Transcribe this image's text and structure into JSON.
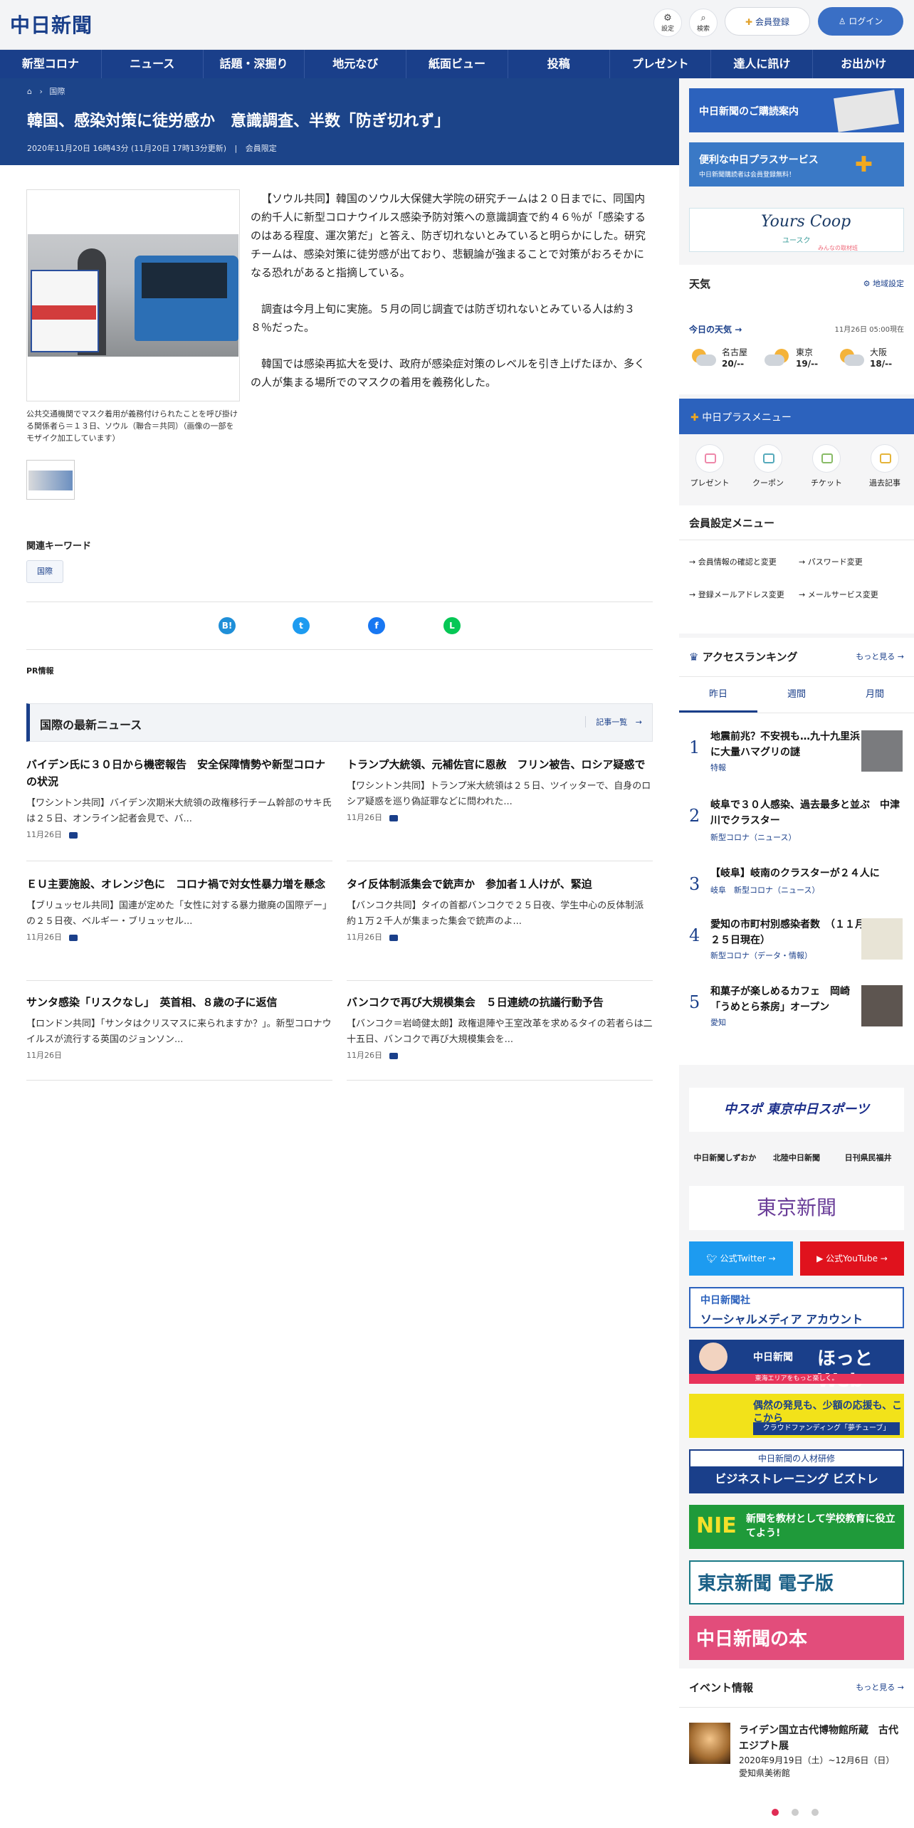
{
  "header": {
    "logo": "中日新聞",
    "settings_label": "設定",
    "search_label": "検索",
    "register_label": "会員登録",
    "login_label": "ログイン"
  },
  "nav": [
    "新型コロナ",
    "ニュース",
    "話題・深掘り",
    "地元なび",
    "紙面ビュー",
    "投稿",
    "プレゼント",
    "達人に訊け",
    "お出かけ"
  ],
  "article": {
    "breadcrumb": "国際",
    "title": "韓国、感染対策に徒労感か　意識調査、半数「防ぎ切れず」",
    "date": "2020年11月20日 16時43分 (11月20日 17時13分更新)",
    "members_only": "会員限定",
    "caption": "公共交通機関でマスク着用が義務付けられたことを呼び掛ける関係者ら＝１３日、ソウル（聯合＝共同）（画像の一部をモザイク加工しています）",
    "paragraphs": [
      "【ソウル共同】韓国のソウル大保健大学院の研究チームは２０日までに、同国内の約千人に新型コロナウイルス感染予防対策への意識調査で約４６％が「感染するのはある程度、運次第だ」と答え、防ぎ切れないとみていると明らかにした。研究チームは、感染対策に徒労感が出ており、悲観論が強まることで対策がおろそかになる恐れがあると指摘している。",
      "調査は今月上旬に実施。５月の同じ調査では防ぎ切れないとみている人は約３８％だった。",
      "韓国では感染再拡大を受け、政府が感染症対策のレベルを引き上げたほか、多くの人が集まる場所でのマスクの着用を義務化した。"
    ],
    "keywords_title": "関連キーワード",
    "keyword": "国際",
    "pr_label": "PR情報",
    "share": {
      "hatena": "B!",
      "twitter": "t",
      "facebook": "f",
      "line": "L"
    }
  },
  "latest": {
    "title": "国際の最新ニュース",
    "more": "記事一覧",
    "items": [
      {
        "title": "バイデン氏に３０日から機密報告　安全保障情勢や新型コロナの状況",
        "desc": "【ワシントン共同】バイデン次期米大統領の政権移行チーム幹部のサキ氏は２５日、オンライン記者会見で、バ...",
        "date": "11月26日"
      },
      {
        "title": "トランプ大統領、元補佐官に恩赦　フリン被告、ロシア疑惑で",
        "desc": "【ワシントン共同】トランプ米大統領は２５日、ツイッターで、自身のロシア疑惑を巡り偽証罪などに問われた...",
        "date": "11月26日"
      },
      {
        "title": "ＥＵ主要施設、オレンジ色に　コロナ禍で対女性暴力増を懸念",
        "desc": "【ブリュッセル共同】国連が定めた「女性に対する暴力撤廃の国際デー」の２５日夜、ベルギー・ブリュッセル...",
        "date": "11月26日"
      },
      {
        "title": "タイ反体制派集会で銃声か　参加者１人けが、緊迫",
        "desc": "【バンコク共同】タイの首都バンコクで２５日夜、学生中心の反体制派約１万２千人が集まった集会で銃声のよ...",
        "date": "11月26日"
      },
      {
        "title": "サンタ感染「リスクなし」　英首相、８歳の子に返信",
        "desc": "【ロンドン共同】「サンタはクリスマスに来られますか？」。新型コロナウイルスが流行する英国のジョンソン...",
        "date": "11月26日"
      },
      {
        "title": "バンコクで再び大規模集会　５日連続の抗議行動予告",
        "desc": "【バンコク＝岩崎健太朗】政権退陣や王室改革を求めるタイの若者らは二十五日、バンコクで再び大規模集会を...",
        "date": "11月26日"
      }
    ]
  },
  "sidebar": {
    "banner1": "中日新聞のご購読案内",
    "banner2_title": "便利な中日プラスサービス",
    "banner2_sub": "中日新聞購読者は会員登録無料！",
    "banner3_title": "Yours Coop",
    "banner3_sub": "ユースク",
    "banner3_sub2": "みんなの取材班",
    "weather": {
      "title": "天気",
      "setting": "地域設定",
      "today": "今日の天気",
      "time": "11月26日 05:00現在",
      "cities": [
        {
          "city": "名古屋",
          "temp": "20/--"
        },
        {
          "city": "東京",
          "temp": "19/--"
        },
        {
          "city": "大阪",
          "temp": "18/--"
        }
      ]
    },
    "plus_menu_title": "中日プラスメニュー",
    "plus_menu": [
      "プレゼント",
      "クーポン",
      "チケット",
      "過去記事"
    ],
    "member_menu_title": "会員設定メニュー",
    "member_menu": [
      "会員情報の確認と変更",
      "パスワード変更",
      "登録メールアドレス変更",
      "メールサービス変更"
    ],
    "ranking": {
      "title": "アクセスランキング",
      "more": "もっと見る",
      "tabs": [
        "昨日",
        "週間",
        "月間"
      ],
      "items": [
        {
          "n": "1",
          "title": "地震前兆？不安視も…九十九里浜に大量ハマグリの謎",
          "cat": "特報"
        },
        {
          "n": "2",
          "title": "岐阜で３０人感染、過去最多と並ぶ　中津川でクラスター",
          "cat": "新型コロナ（ニュース）"
        },
        {
          "n": "3",
          "title": "【岐阜】岐南のクラスターが２４人に",
          "cat": "岐阜　新型コロナ（ニュース）"
        },
        {
          "n": "4",
          "title": "愛知の市町村別感染者数　（１１月２５日現在）",
          "cat": "新型コロナ（データ・情報）"
        },
        {
          "n": "5",
          "title": "和菓子が楽しめるカフェ　岡崎「うめとら茶房」オープン",
          "cat": "愛知"
        }
      ]
    },
    "chuspo": "中スポ 東京中日スポーツ",
    "links": [
      "中日新聞しずおか",
      "北陸中日新聞",
      "日刊県民福井"
    ],
    "tokyo_shimbun": "東京新聞",
    "twitter_label": "公式Twitter",
    "youtube_label": "公式YouTube",
    "sns_a": "中日新聞社",
    "sns_b": "ソーシャルメディア アカウント",
    "hotto_a": "中日新聞",
    "hotto_b": "ほっと Web",
    "hotto_strip": "東海エリアをもっと楽しく。",
    "crowd_a": "偶然の発見も、少額の応援も、ここから",
    "crowd_strip": "クラウドファンディング「夢チューブ」",
    "biz_top": "中日新聞の人材研修",
    "biz_a": "ビジネストレーニング ビズトレ",
    "nie_a": "NIE",
    "nie_b": "新聞を教材として学校教育に役立てよう!",
    "denshi": "東京新聞 電子版",
    "book": "中日新聞の本",
    "events": {
      "title": "イベント情報",
      "more": "もっと見る",
      "event_title": "ライデン国立古代博物館所蔵　古代エジプト展",
      "event_date": "2020年9月19日（土）~12月6日（日）",
      "event_place": "愛知県美術館"
    }
  }
}
